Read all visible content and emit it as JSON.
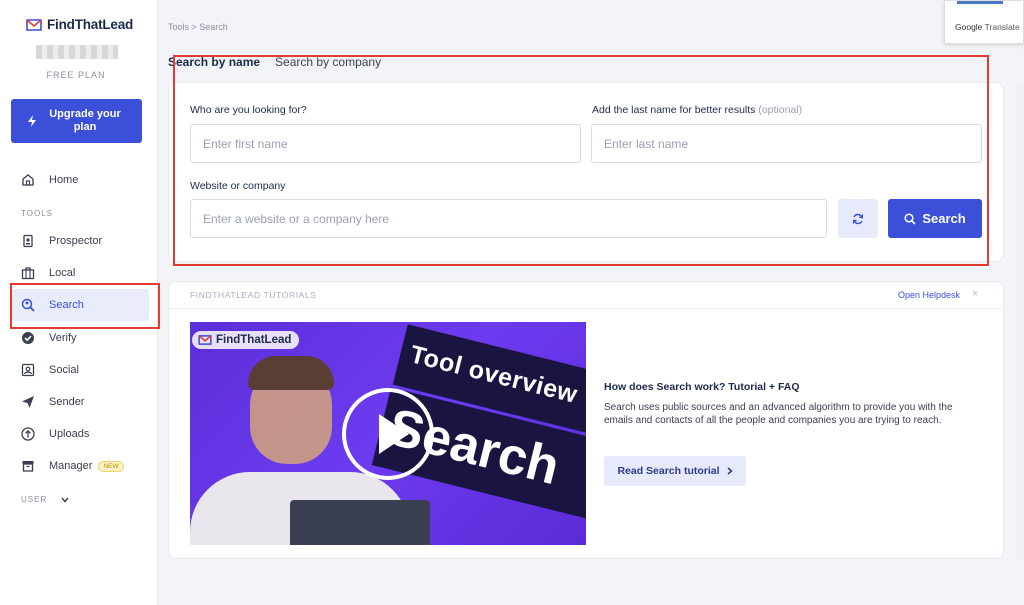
{
  "app": {
    "name": "FindThatLead",
    "plan": "FREE PLAN"
  },
  "sidebar": {
    "upgrade_label": "Upgrade your plan",
    "tools_label": "TOOLS",
    "user_label": "USER",
    "new_badge": "NEW",
    "items": [
      {
        "key": "home",
        "label": "Home"
      },
      {
        "key": "prospector",
        "label": "Prospector"
      },
      {
        "key": "local",
        "label": "Local"
      },
      {
        "key": "search",
        "label": "Search",
        "active": true
      },
      {
        "key": "verify",
        "label": "Verify"
      },
      {
        "key": "social",
        "label": "Social"
      },
      {
        "key": "sender",
        "label": "Sender"
      },
      {
        "key": "uploads",
        "label": "Uploads"
      },
      {
        "key": "manager",
        "label": "Manager"
      }
    ]
  },
  "breadcrumb": "Tools > Search",
  "tabs": [
    {
      "label": "Search by name",
      "active": true
    },
    {
      "label": "Search by company",
      "active": false
    }
  ],
  "search_form": {
    "first_name_label": "Who are you looking for?",
    "first_name_placeholder": "Enter first name",
    "last_name_label": "Add the last name for better results",
    "last_name_optional": "(optional)",
    "last_name_placeholder": "Enter last name",
    "website_label": "Website or company",
    "website_placeholder": "Enter a website or a company here",
    "search_button": "Search"
  },
  "tutorials": {
    "title": "FINDTHATLEAD TUTORIALS",
    "helpdesk_link": "Open Helpdesk",
    "close": "×",
    "video_logo": "FindThatLead",
    "video_banner_1": "Tool overview",
    "video_banner_2": "Search",
    "heading": "How does Search work? Tutorial + FAQ",
    "description": "Search uses public sources and an advanced algorithm to provide you with the emails and contacts of all the people and companies you are trying to reach.",
    "button": "Read Search tutorial"
  },
  "google_translate": {
    "google": "Google",
    "translate": "Translate"
  },
  "colors": {
    "accent": "#3b4fd8",
    "highlight": "#e33b32"
  },
  "icons": {
    "refresh": "refresh-icon",
    "search": "search-icon",
    "chevron": "chevron-right-icon",
    "play": "play-icon"
  }
}
